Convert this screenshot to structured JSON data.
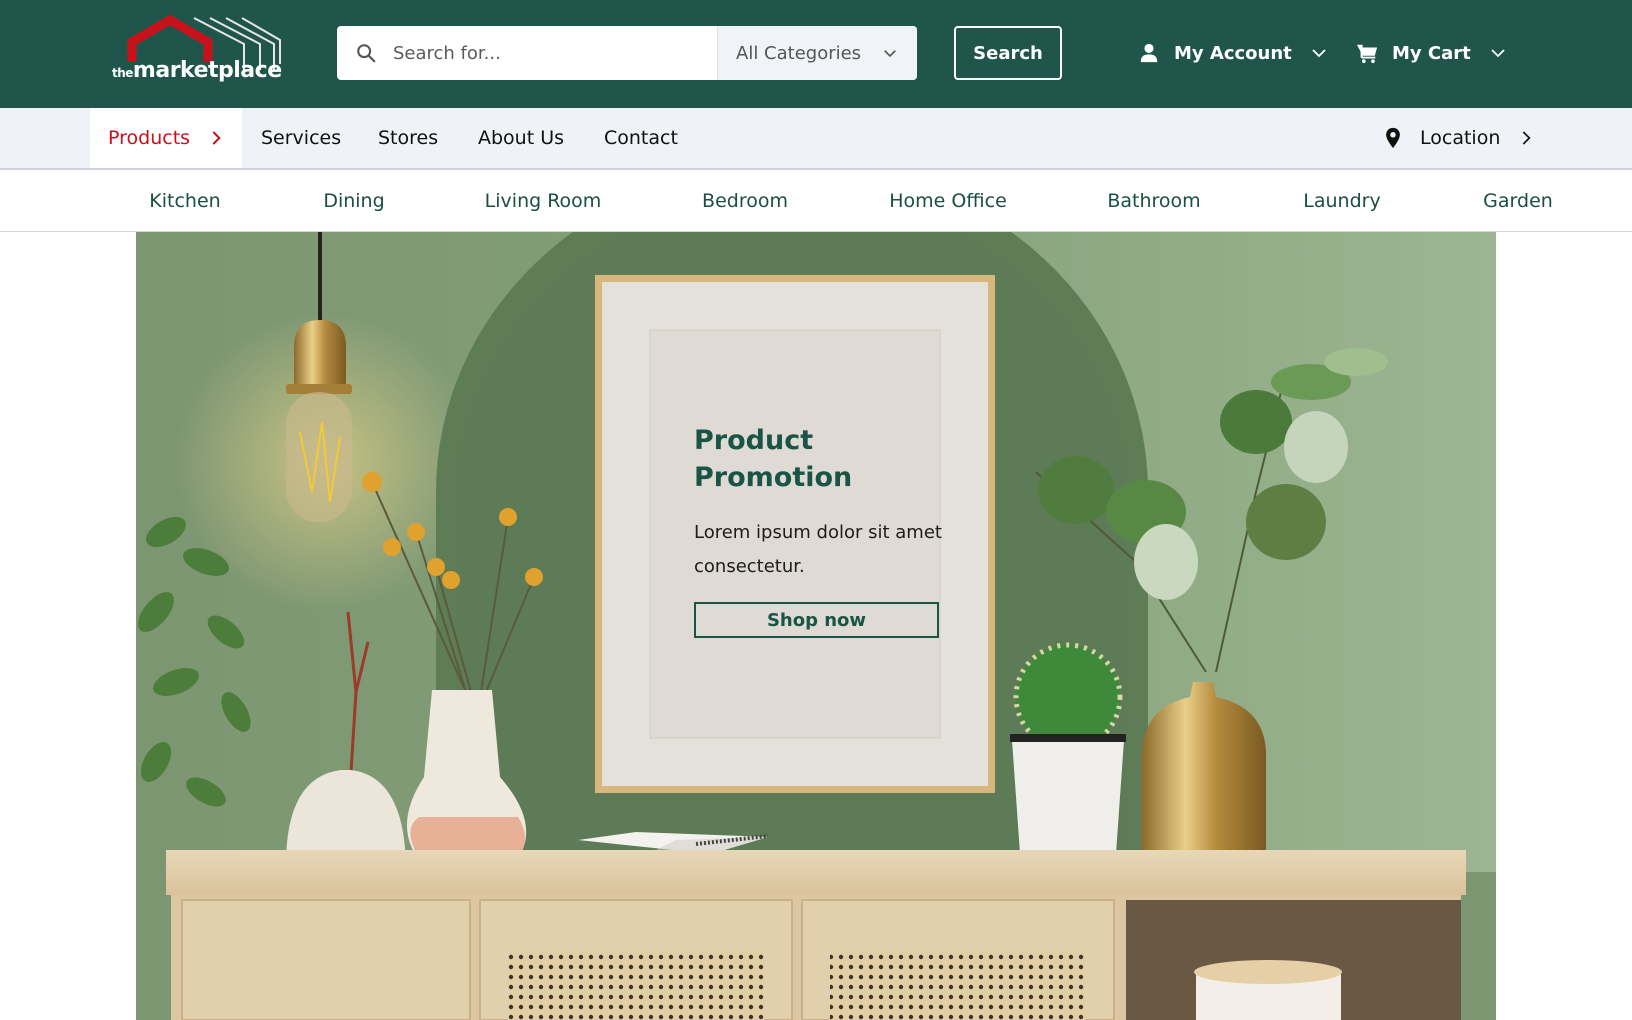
{
  "header": {
    "logo": {
      "prefix": "the",
      "name": "marketplace"
    },
    "search": {
      "placeholder": "Search for...",
      "value": ""
    },
    "category_select": {
      "selected": "All Categories"
    },
    "search_button": "Search",
    "account_label": "My Account",
    "cart_label": "My Cart"
  },
  "main_nav": {
    "items": [
      {
        "label": "Products",
        "active": true
      },
      {
        "label": "Services"
      },
      {
        "label": "Stores"
      },
      {
        "label": "About Us"
      },
      {
        "label": "Contact"
      }
    ],
    "location_label": "Location"
  },
  "sub_nav": {
    "items": [
      "Kitchen",
      "Dining",
      "Living Room",
      "Bedroom",
      "Home Office",
      "Bathroom",
      "Laundry",
      "Garden"
    ]
  },
  "hero": {
    "title_line1": "Product",
    "title_line2": "Promotion",
    "body": "Lorem ipsum dolor sit amet consectetur.",
    "cta": "Shop now"
  },
  "colors": {
    "brand_green": "#20554b",
    "accent_red": "#c8121b",
    "nav_bg": "#eff2f6",
    "text_green": "#1a5446"
  }
}
